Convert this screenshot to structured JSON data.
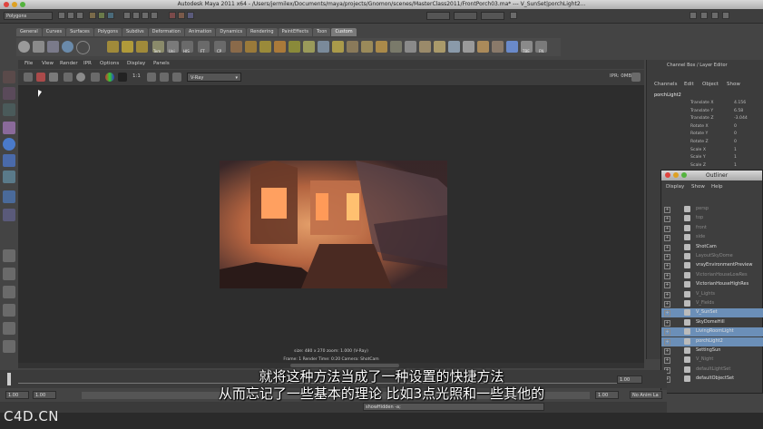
{
  "window": {
    "title": "Autodesk Maya 2011 x64 - /Users/jermilex/Documents/maya/projects/Gnomon/scenes/MasterClass2011/FrontPorch03.ma* --- V_SunSet|porchLight2..."
  },
  "statusline": {
    "mode": "Polygons"
  },
  "shelf": {
    "tabs": [
      "General",
      "Curves",
      "Surfaces",
      "Polygons",
      "Subdivs",
      "Deformation",
      "Animation",
      "Dynamics",
      "Rendering",
      "PaintEffects",
      "Toon",
      "Custom"
    ],
    "active_tab": "Custom",
    "icon_labels": [
      "Tem",
      "Uni",
      "HIS",
      "FT",
      "CP",
      "TBE",
      "FN"
    ]
  },
  "viewport": {
    "menu": [
      "File",
      "View",
      "Render",
      "IPR",
      "Options",
      "Display",
      "Panels"
    ],
    "renderer_select": "V-Ray",
    "ratio_label": "1:1",
    "ipr_label": "IPR: 0MB",
    "info_line1": "size: 480 x 270  zoom: 1.000      (V-Ray)",
    "info_line2": "Frame: 1        Render Time: 0:20        Camera: ShotCam"
  },
  "channelbox": {
    "header": "Channel Box / Layer Editor",
    "menu": [
      "Channels",
      "Edit",
      "Object",
      "Show"
    ],
    "object": "porchLight2",
    "attributes": [
      "Translate X",
      "Translate Y",
      "Translate Z",
      "Rotate X",
      "Rotate Y",
      "Rotate Z",
      "Scale X",
      "Scale Y",
      "Scale Z"
    ],
    "values": [
      "4.156",
      "6.58",
      "-3.044",
      "0",
      "0",
      "0",
      "1",
      "1",
      "1"
    ]
  },
  "outliner": {
    "title": "Outliner",
    "menu": [
      "Display",
      "Show",
      "Help"
    ],
    "items": [
      {
        "label": "persp",
        "dim": true,
        "selected": false
      },
      {
        "label": "top",
        "dim": true,
        "selected": false
      },
      {
        "label": "front",
        "dim": true,
        "selected": false
      },
      {
        "label": "side",
        "dim": true,
        "selected": false
      },
      {
        "label": "ShotCam",
        "dim": false,
        "selected": false
      },
      {
        "label": "LayoutSkyDome",
        "dim": true,
        "selected": false
      },
      {
        "label": "vrayEnvironmentPreview",
        "dim": false,
        "selected": false
      },
      {
        "label": "VictorianHouseLowRes",
        "dim": true,
        "selected": false
      },
      {
        "label": "VictorianHouseHighRes",
        "dim": false,
        "selected": false
      },
      {
        "label": "V_Lights",
        "dim": true,
        "selected": false
      },
      {
        "label": "V_Fields",
        "dim": true,
        "selected": false
      },
      {
        "label": "V_SunSet",
        "dim": false,
        "selected": true
      },
      {
        "label": "SkyDomeHill",
        "dim": false,
        "selected": false
      },
      {
        "label": "LivingRoomLight",
        "dim": false,
        "selected": true
      },
      {
        "label": "porchLight2",
        "dim": false,
        "selected": true
      },
      {
        "label": "SettingSun",
        "dim": false,
        "selected": false
      },
      {
        "label": "V_Night",
        "dim": true,
        "selected": false
      },
      {
        "label": "defaultLightSet",
        "dim": true,
        "selected": false
      },
      {
        "label": "defaultObjectSet",
        "dim": false,
        "selected": false
      }
    ]
  },
  "timeline": {
    "start": "1.00",
    "end": "1.00",
    "current": "1.00",
    "anim_layer": "No Anim La"
  },
  "command": {
    "text": "showHidden -a;"
  },
  "subtitles": {
    "line1": "就将这种方法当成了一种设置的快捷方法",
    "line2": "从而忘记了一些基本的理论 比如3点光照和一些其他的"
  },
  "watermark": {
    "text": "C4D.CN"
  }
}
